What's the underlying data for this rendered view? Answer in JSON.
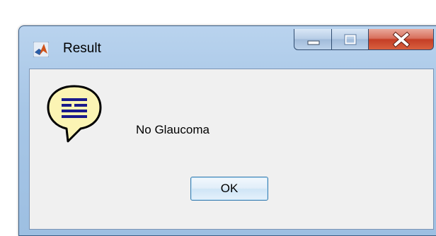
{
  "window": {
    "title": "Result",
    "app_icon": "matlab-icon"
  },
  "caption_buttons": {
    "minimize": "minimize-icon",
    "maximize": "maximize-icon",
    "close": "close-icon"
  },
  "dialog": {
    "icon": "help-speech-bubble-icon",
    "message": "No Glaucoma",
    "ok_label": "OK"
  },
  "colors": {
    "frame": "#a7c6e6",
    "client_bg": "#f0f0f0",
    "close_button": "#c43e25",
    "icon_fill": "#fbf4b4",
    "icon_lines": "#1a1a8c"
  }
}
